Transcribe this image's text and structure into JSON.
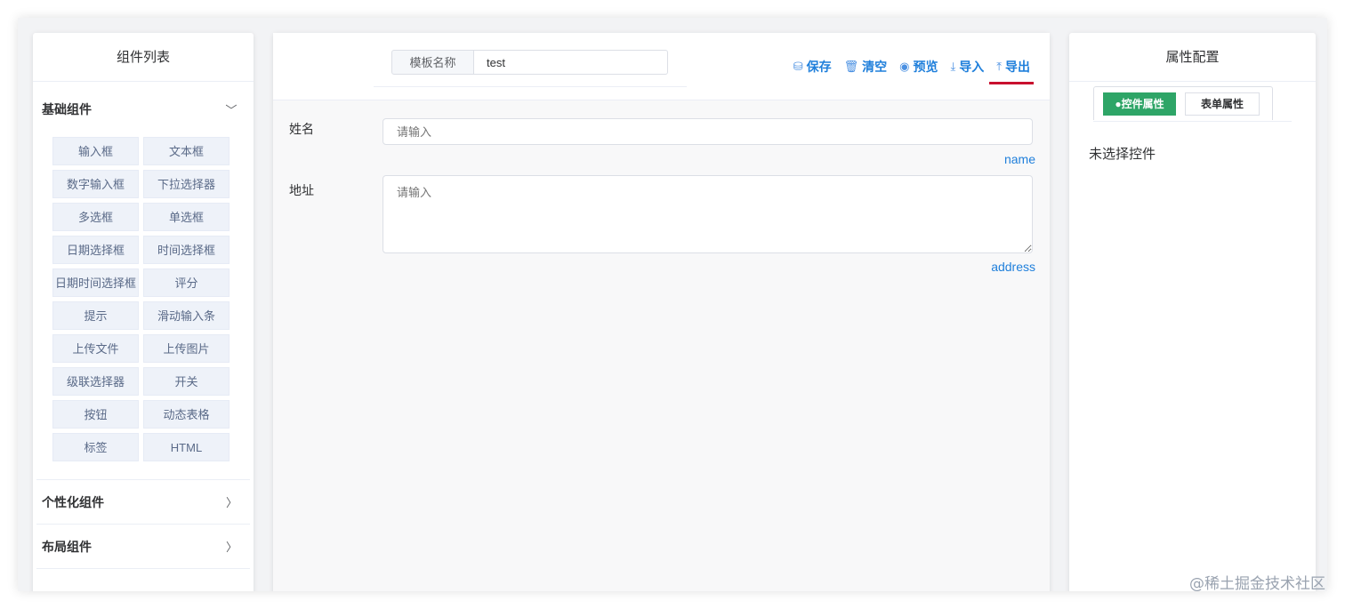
{
  "left_panel": {
    "title": "组件列表",
    "groups": [
      {
        "label": "基础组件",
        "expanded": true,
        "items": [
          "输入框",
          "文本框",
          "数字输入框",
          "下拉选择器",
          "多选框",
          "单选框",
          "日期选择框",
          "时间选择框",
          "日期时间选择框",
          "评分",
          "提示",
          "滑动输入条",
          "上传文件",
          "上传图片",
          "级联选择器",
          "开关",
          "按钮",
          "动态表格",
          "标签",
          "HTML"
        ]
      },
      {
        "label": "个性化组件",
        "expanded": false
      },
      {
        "label": "布局组件",
        "expanded": false
      }
    ]
  },
  "toolbar": {
    "template_label": "模板名称",
    "template_value": "test",
    "actions": [
      {
        "label": "保存",
        "icon": "database-icon"
      },
      {
        "label": "清空",
        "icon": "trash-icon"
      },
      {
        "label": "预览",
        "icon": "eye-icon"
      },
      {
        "label": "导入",
        "icon": "download-icon"
      },
      {
        "label": "导出",
        "icon": "upload-icon",
        "active": true
      }
    ]
  },
  "form": {
    "fields": [
      {
        "label": "姓名",
        "placeholder": "请输入",
        "key": "name",
        "type": "input"
      },
      {
        "label": "地址",
        "placeholder": "请输入",
        "key": "address",
        "type": "textarea"
      }
    ]
  },
  "right_panel": {
    "title": "属性配置",
    "tabs": [
      {
        "label": "●控件属性",
        "active": true
      },
      {
        "label": "表单属性",
        "active": false
      }
    ],
    "empty_message": "未选择控件"
  },
  "watermark": "@稀土掘金技术社区",
  "colors": {
    "accent": "#1f7fdb",
    "active_tab": "#2ea567",
    "active_underline": "#c8102e"
  }
}
